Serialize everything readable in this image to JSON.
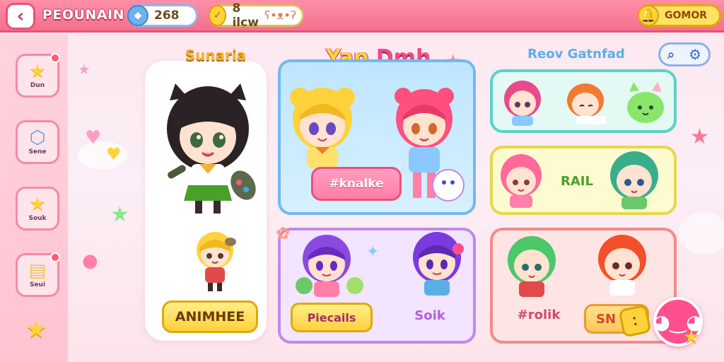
{
  "header": {
    "back_icon": "back-arrow-icon",
    "title": "PEOUNAIN",
    "gems": {
      "icon": "gem-icon",
      "value": "268"
    },
    "gold": {
      "icon": "gold-coin-icon",
      "value": "8 ilcw",
      "extra_icon": "bear-icon"
    },
    "premium": {
      "icon": "bell-coin-icon",
      "label": "GOMOR"
    }
  },
  "sidebar": {
    "items": [
      {
        "icon": "star-icon",
        "label": "Dun"
      },
      {
        "icon": "box-icon",
        "label": "Sene"
      },
      {
        "icon": "star-heart-icon",
        "label": "Souk"
      },
      {
        "icon": "chest-icon",
        "label": "Seui"
      }
    ],
    "bottom_icon": "star-icon"
  },
  "character_panel": {
    "heading": "Sunaria",
    "button": "ANIMHEE"
  },
  "center": {
    "heading_part1": "Yap ",
    "heading_part2": "Dmh",
    "make_button": "#knalke",
    "presets_button": "Piecails",
    "sort_label": "Soik"
  },
  "right": {
    "heading": "Reov Gatnfad",
    "search_icon": "search-icon",
    "settings_icon": "gear-icon",
    "yellow_card_label": "RAIL",
    "coral_card_label": "#rolik",
    "sn_button": "SN",
    "dice_icon": "dice-icon",
    "fab_icon": "chat-face-icon"
  },
  "colors": {
    "topbar": "#f46f8d",
    "accent_yellow": "#ffd23c",
    "card_blue_border": "#74b8ee",
    "card_purple_border": "#c08ae6",
    "card_teal_border": "#5ad2c8",
    "card_yellow_border": "#e6d84a",
    "card_coral_border": "#f28a8a"
  }
}
